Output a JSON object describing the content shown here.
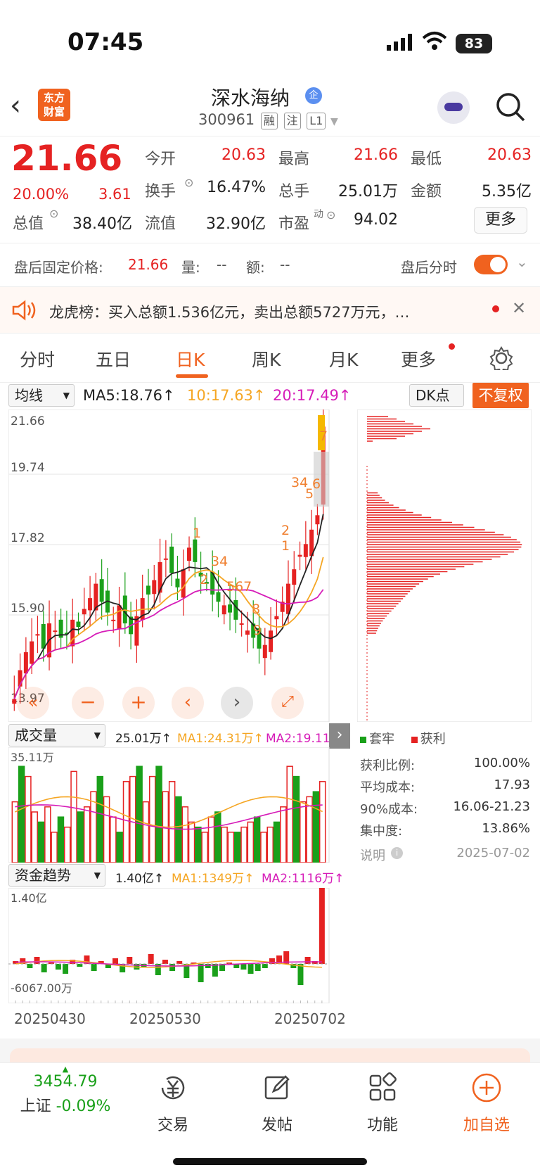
{
  "status": {
    "time": "07:45",
    "battery": "83"
  },
  "header": {
    "back_glyph": "‹",
    "logo_line1": "东方",
    "logo_line2": "财富",
    "name": "深水海纳",
    "badge": "企",
    "code": "300961",
    "tags": [
      "融",
      "注",
      "L1"
    ]
  },
  "quote": {
    "price": "21.66",
    "pct": "20.00%",
    "chg": "3.61",
    "rows": [
      [
        {
          "l": "今开",
          "v": "20.63",
          "red": true
        },
        {
          "l": "最高",
          "v": "21.66",
          "red": true
        },
        {
          "l": "最低",
          "v": "20.63",
          "red": true
        }
      ],
      [
        {
          "l": "换手",
          "v": "16.47%",
          "red": false
        },
        {
          "l": "总手",
          "v": "25.01万",
          "red": false
        },
        {
          "l": "金额",
          "v": "5.35亿",
          "red": false
        }
      ]
    ],
    "row3": {
      "l1": "总值",
      "v1": "38.40亿",
      "l2": "流值",
      "v2": "32.90亿",
      "l3": "市盈",
      "sup": "动",
      "v3": "94.02"
    },
    "more": "更多"
  },
  "afterhours": {
    "label": "盘后固定价格:",
    "price": "21.66",
    "vol_label": "量:",
    "vol": "--",
    "amt_label": "额:",
    "amt": "--",
    "switch_label": "盘后分时"
  },
  "lhb": {
    "text": "龙虎榜：买入总额1.536亿元，卖出总额5727万元，…"
  },
  "tabs": [
    "分时",
    "五日",
    "日K",
    "周K",
    "月K",
    "更多"
  ],
  "ma": {
    "selector": "均线",
    "ma5": "MA5:18.76↑",
    "ma10": "10:17.63↑",
    "ma20": "20:17.49↑",
    "dk": "DK点",
    "fuquan": "不复权"
  },
  "kline": {
    "ticks": [
      "21.66",
      "19.74",
      "17.82",
      "15.90",
      "13.97"
    ],
    "marks": [
      "1",
      "2",
      "34",
      "567",
      "8",
      "9",
      "1",
      "2",
      "34",
      "5",
      "6",
      "7"
    ]
  },
  "vol": {
    "selector": "成交量",
    "val": "25.01万↑",
    "ma1": "MA1:24.31万↑",
    "ma2": "MA2:19.11万",
    "top": "35.11万"
  },
  "fund": {
    "selector": "资金趋势",
    "val": "1.40亿↑",
    "ma1": "MA1:1349万↑",
    "ma2": "MA2:1116万↑",
    "top": "1.40亿",
    "bottom": "-6067.00万"
  },
  "dates": [
    "20250430",
    "20250530",
    "20250702"
  ],
  "chip": {
    "legend1": "套牢",
    "legend2": "获利",
    "rows": [
      {
        "l": "获利比例:",
        "v": "100.00%"
      },
      {
        "l": "平均成本:",
        "v": "17.93"
      },
      {
        "l": "90%成本:",
        "v": "16.06-21.23"
      },
      {
        "l": "集中度:",
        "v": "13.86%"
      }
    ],
    "note": "说明",
    "date": "2025-07-02"
  },
  "nav": {
    "index_val": "3454.79",
    "index_name": "上证",
    "index_pct": "-0.09%",
    "items": [
      "交易",
      "发帖",
      "功能",
      "加自选"
    ]
  },
  "colors": {
    "red": "#e52222",
    "green": "#1aa01a",
    "orange": "#f0621f",
    "ma5": "#222222",
    "ma10": "#f5a623",
    "ma20": "#d61cb8"
  }
}
